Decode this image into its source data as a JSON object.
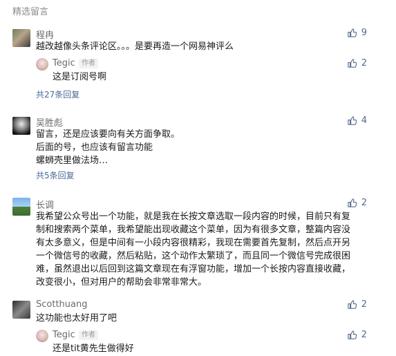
{
  "section_title": "精选留言",
  "comments": [
    {
      "name": "程冉",
      "text_lines": [
        "越改越像头条评论区。。。是要再造一个网易神评么"
      ],
      "likes": "9",
      "reply": {
        "name": "Tegic",
        "tag": "作者",
        "text": "这是订阅号啊",
        "likes": "2"
      },
      "replies_link": "共27条回复"
    },
    {
      "name": "吴胜彪",
      "text_lines": [
        "留言，还是应该要向有关方面争取。",
        "后面的号，也应该有留言功能",
        "螺蛳壳里做法场…"
      ],
      "likes": "4",
      "replies_link": "共5条回复"
    },
    {
      "name": "长调",
      "text_lines": [
        "我希望公众号出一个功能，就是我在长按文章选取一段内容的时候，目前只有复",
        "制和搜索两个菜单，我希望能出现收藏这个菜单，因为有很多文章，整篇内容没",
        "有太多意义，但是中间有一小段内容很精彩，我现在需要首先复制，然后点开另",
        "一个微信号的收藏，然后粘贴，这个动作太繁琐了，而且同一个微信号完成很困",
        "难，虽然退出以后回到这篇文章现在有浮窗功能，增加一个长按内容直接收藏，",
        "改变很小，但对用户的帮助会非常非常大。"
      ],
      "likes": "2"
    },
    {
      "name": "Scotthuang",
      "text_lines": [
        "这功能也太好用了吧"
      ],
      "likes": "2",
      "reply": {
        "name": "Tegic",
        "tag": "作者",
        "text": "还是tit黄先生做得好",
        "likes": "2"
      }
    }
  ]
}
